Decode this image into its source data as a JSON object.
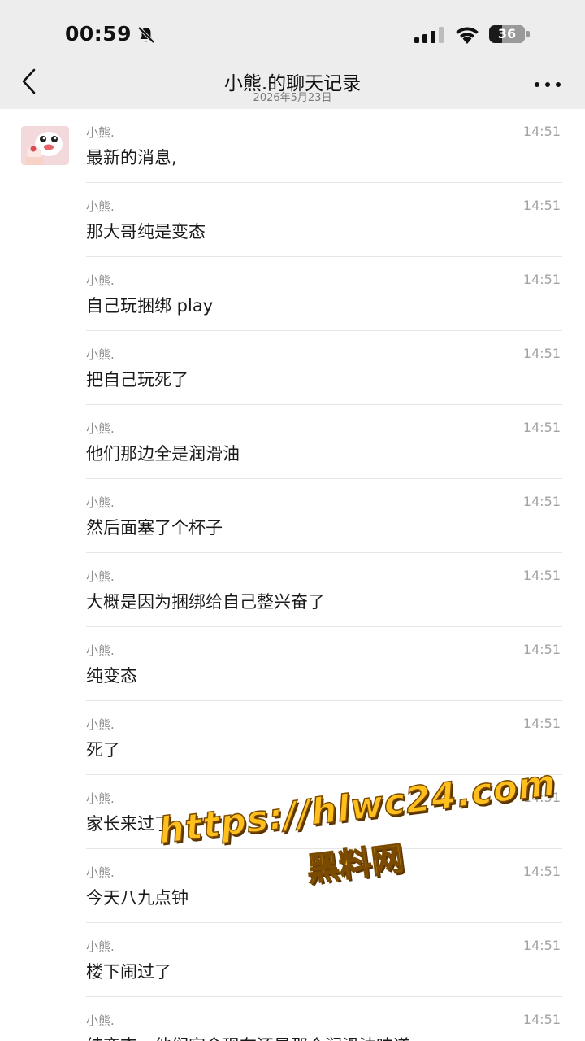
{
  "status_bar": {
    "time": "00:59",
    "battery_level": "36",
    "icons": [
      "bell-slash-icon",
      "signal-icon",
      "wifi-icon",
      "battery-icon"
    ]
  },
  "nav": {
    "title": "小熊.的聊天记录",
    "subtitle": "2026年5月23日",
    "icons": [
      "chevron-left-icon",
      "more-icon"
    ]
  },
  "colors": {
    "header_bg": "#ededed",
    "text_primary": "#1a1a1a",
    "text_secondary": "#8c8c8c",
    "watermark": "#ffc01e"
  },
  "messages": [
    {
      "sender": "小熊.",
      "time": "14:51",
      "text": "最新的消息,"
    },
    {
      "sender": "小熊.",
      "time": "14:51",
      "text": "那大哥纯是变态"
    },
    {
      "sender": "小熊.",
      "time": "14:51",
      "text": "自己玩捆绑 play"
    },
    {
      "sender": "小熊.",
      "time": "14:51",
      "text": "把自己玩死了"
    },
    {
      "sender": "小熊.",
      "time": "14:51",
      "text": "他们那边全是润滑油"
    },
    {
      "sender": "小熊.",
      "time": "14:51",
      "text": "然后面塞了个杯子"
    },
    {
      "sender": "小熊.",
      "time": "14:51",
      "text": "大概是因为捆绑给自己整兴奋了"
    },
    {
      "sender": "小熊.",
      "time": "14:51",
      "text": "纯变态"
    },
    {
      "sender": "小熊.",
      "time": "14:51",
      "text": "死了"
    },
    {
      "sender": "小熊.",
      "time": "14:51",
      "text": "家长来过了"
    },
    {
      "sender": "小熊.",
      "time": "14:51",
      "text": "今天八九点钟"
    },
    {
      "sender": "小熊.",
      "time": "14:51",
      "text": "楼下闹过了"
    },
    {
      "sender": "小熊.",
      "time": "14:51",
      "text": "纯变态，他们宿舍现在还是那个润滑油味道"
    }
  ],
  "watermark": {
    "url": "https://hlwc24.com",
    "name": "黑料网"
  }
}
